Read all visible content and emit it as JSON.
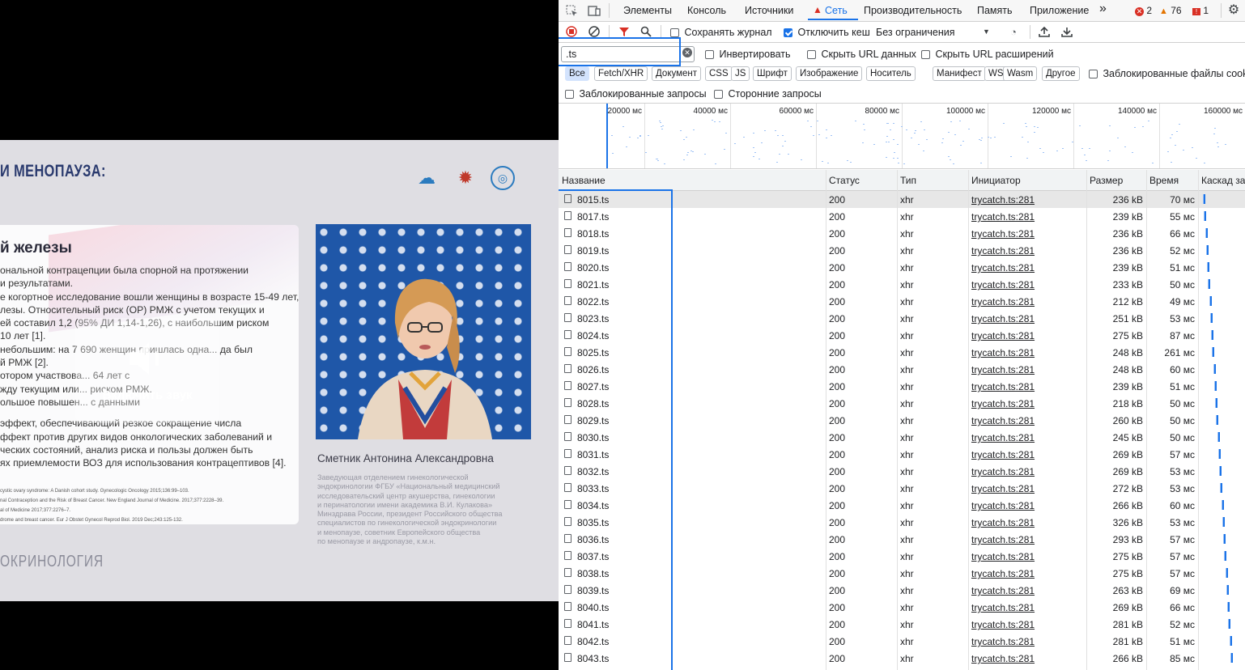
{
  "video": {
    "slide_title": "И МЕНОПАУЗА:",
    "card_heading": "й железы",
    "card_lines": [
      "ональной контрацепции была спорной на протяжении",
      "и результатами.",
      "е когортное исследование вошли женщины в возрасте 15-49 лет,",
      "лезы. Относительный риск (ОР) РМЖ с учетом текущих и",
      "ей составил 1,2 (95% ДИ 1,14-1,26), с наибольшим риском",
      "10 лет [1].",
      "небольшим: на 7 690 женщин пришлась одна... да был",
      "й РМЖ [2].",
      "отором участвова... 64 лет с",
      "жду текущим или... риском РМЖ.",
      "ольшое повышен... с данными",
      "",
      "эффект, обеспечивающий резкое сокращение числа",
      "ффект против других видов онкологических заболеваний и",
      "ческих состояний, анализ риска и пользы должен быть",
      "ях приемлемости ВОЗ для использования контрацептивов [4]."
    ],
    "refs": [
      "cystic ovary syndrome: A Danish cohort study. Gynecologic Oncology 2015;136:99–103.",
      "nal Contraception and the Risk of Breast Cancer. New England Journal of Medicine. 2017;377:2228–39.",
      "al of Medicine 2017;377:2276–7.",
      "drome and breast cancer. Eur J Obstet Gynecol Reprod Biol. 2019 Dec;243:125-132."
    ],
    "footer": "ОКРИНОЛОГИЯ",
    "speaker_name": "Сметник Антонина Александровна",
    "speaker_desc": [
      "Заведующая отделением гинекологической",
      "эндокринологии ФГБУ «Национальный медицинский",
      "исследовательский центр акушерства, гинекологии",
      "и перинатологии имени академика В.И. Кулакова»",
      "Минздрава России, президент Российского общества",
      "специалистов по гинекологической эндокринологии",
      "и менопаузе, советник Европейского общества",
      "по менопаузе и андропаузе, к.м.н."
    ],
    "unmute_label": "Включить звук"
  },
  "devtools": {
    "tabs": [
      "Элементы",
      "Консоль",
      "Источники",
      "Сеть",
      "Производительность",
      "Память",
      "Приложение"
    ],
    "active_tab": "Сеть",
    "more": "»",
    "errors": "2",
    "warnings": "76",
    "issues": "1",
    "toolbar": {
      "preserve_log": "Сохранять журнал",
      "disable_cache": "Отключить кеш",
      "throttle": "Без ограничения"
    },
    "filter": {
      "value": ".ts",
      "invert": "Инвертировать",
      "hide_data_urls": "Скрыть URL данных",
      "hide_ext_urls": "Скрыть URL расширений"
    },
    "types": [
      "Все",
      "Fetch/XHR",
      "Документ",
      "CSS",
      "JS",
      "Шрифт",
      "Изображение",
      "Носитель",
      "Манифест",
      "WS",
      "Wasm",
      "Другое"
    ],
    "blocked_cookies": "Заблокированные файлы cookie",
    "blocked_requests": "Заблокированные запросы",
    "third_party": "Сторонние запросы",
    "overview_labels": [
      "20000 мс",
      "40000 мс",
      "60000 мс",
      "80000 мс",
      "100000 мс",
      "120000 мс",
      "140000 мс",
      "160000 мс"
    ],
    "columns": [
      "Название",
      "Статус",
      "Тип",
      "Инициатор",
      "Размер",
      "Время",
      "Каскад за"
    ],
    "rows": [
      {
        "name": "8015.ts",
        "status": "200",
        "type": "xhr",
        "initiator": "trycatch.ts:281",
        "size": "236 kB",
        "time": "70 мс"
      },
      {
        "name": "8017.ts",
        "status": "200",
        "type": "xhr",
        "initiator": "trycatch.ts:281",
        "size": "239 kB",
        "time": "55 мс"
      },
      {
        "name": "8018.ts",
        "status": "200",
        "type": "xhr",
        "initiator": "trycatch.ts:281",
        "size": "236 kB",
        "time": "66 мс"
      },
      {
        "name": "8019.ts",
        "status": "200",
        "type": "xhr",
        "initiator": "trycatch.ts:281",
        "size": "236 kB",
        "time": "52 мс"
      },
      {
        "name": "8020.ts",
        "status": "200",
        "type": "xhr",
        "initiator": "trycatch.ts:281",
        "size": "239 kB",
        "time": "51 мс"
      },
      {
        "name": "8021.ts",
        "status": "200",
        "type": "xhr",
        "initiator": "trycatch.ts:281",
        "size": "233 kB",
        "time": "50 мс"
      },
      {
        "name": "8022.ts",
        "status": "200",
        "type": "xhr",
        "initiator": "trycatch.ts:281",
        "size": "212 kB",
        "time": "49 мс"
      },
      {
        "name": "8023.ts",
        "status": "200",
        "type": "xhr",
        "initiator": "trycatch.ts:281",
        "size": "251 kB",
        "time": "53 мс"
      },
      {
        "name": "8024.ts",
        "status": "200",
        "type": "xhr",
        "initiator": "trycatch.ts:281",
        "size": "275 kB",
        "time": "87 мс"
      },
      {
        "name": "8025.ts",
        "status": "200",
        "type": "xhr",
        "initiator": "trycatch.ts:281",
        "size": "248 kB",
        "time": "261 мс"
      },
      {
        "name": "8026.ts",
        "status": "200",
        "type": "xhr",
        "initiator": "trycatch.ts:281",
        "size": "248 kB",
        "time": "60 мс"
      },
      {
        "name": "8027.ts",
        "status": "200",
        "type": "xhr",
        "initiator": "trycatch.ts:281",
        "size": "239 kB",
        "time": "51 мс"
      },
      {
        "name": "8028.ts",
        "status": "200",
        "type": "xhr",
        "initiator": "trycatch.ts:281",
        "size": "218 kB",
        "time": "50 мс"
      },
      {
        "name": "8029.ts",
        "status": "200",
        "type": "xhr",
        "initiator": "trycatch.ts:281",
        "size": "260 kB",
        "time": "50 мс"
      },
      {
        "name": "8030.ts",
        "status": "200",
        "type": "xhr",
        "initiator": "trycatch.ts:281",
        "size": "245 kB",
        "time": "50 мс"
      },
      {
        "name": "8031.ts",
        "status": "200",
        "type": "xhr",
        "initiator": "trycatch.ts:281",
        "size": "269 kB",
        "time": "57 мс"
      },
      {
        "name": "8032.ts",
        "status": "200",
        "type": "xhr",
        "initiator": "trycatch.ts:281",
        "size": "269 kB",
        "time": "53 мс"
      },
      {
        "name": "8033.ts",
        "status": "200",
        "type": "xhr",
        "initiator": "trycatch.ts:281",
        "size": "272 kB",
        "time": "53 мс"
      },
      {
        "name": "8034.ts",
        "status": "200",
        "type": "xhr",
        "initiator": "trycatch.ts:281",
        "size": "266 kB",
        "time": "60 мс"
      },
      {
        "name": "8035.ts",
        "status": "200",
        "type": "xhr",
        "initiator": "trycatch.ts:281",
        "size": "326 kB",
        "time": "53 мс"
      },
      {
        "name": "8036.ts",
        "status": "200",
        "type": "xhr",
        "initiator": "trycatch.ts:281",
        "size": "293 kB",
        "time": "57 мс"
      },
      {
        "name": "8037.ts",
        "status": "200",
        "type": "xhr",
        "initiator": "trycatch.ts:281",
        "size": "275 kB",
        "time": "57 мс"
      },
      {
        "name": "8038.ts",
        "status": "200",
        "type": "xhr",
        "initiator": "trycatch.ts:281",
        "size": "275 kB",
        "time": "57 мс"
      },
      {
        "name": "8039.ts",
        "status": "200",
        "type": "xhr",
        "initiator": "trycatch.ts:281",
        "size": "263 kB",
        "time": "69 мс"
      },
      {
        "name": "8040.ts",
        "status": "200",
        "type": "xhr",
        "initiator": "trycatch.ts:281",
        "size": "269 kB",
        "time": "66 мс"
      },
      {
        "name": "8041.ts",
        "status": "200",
        "type": "xhr",
        "initiator": "trycatch.ts:281",
        "size": "281 kB",
        "time": "52 мс"
      },
      {
        "name": "8042.ts",
        "status": "200",
        "type": "xhr",
        "initiator": "trycatch.ts:281",
        "size": "281 kB",
        "time": "51 мс"
      },
      {
        "name": "8043.ts",
        "status": "200",
        "type": "xhr",
        "initiator": "trycatch.ts:281",
        "size": "266 kB",
        "time": "85 мс"
      }
    ],
    "colors": {
      "accent": "#1a73e8",
      "error": "#d93025",
      "warning": "#e37400"
    }
  }
}
